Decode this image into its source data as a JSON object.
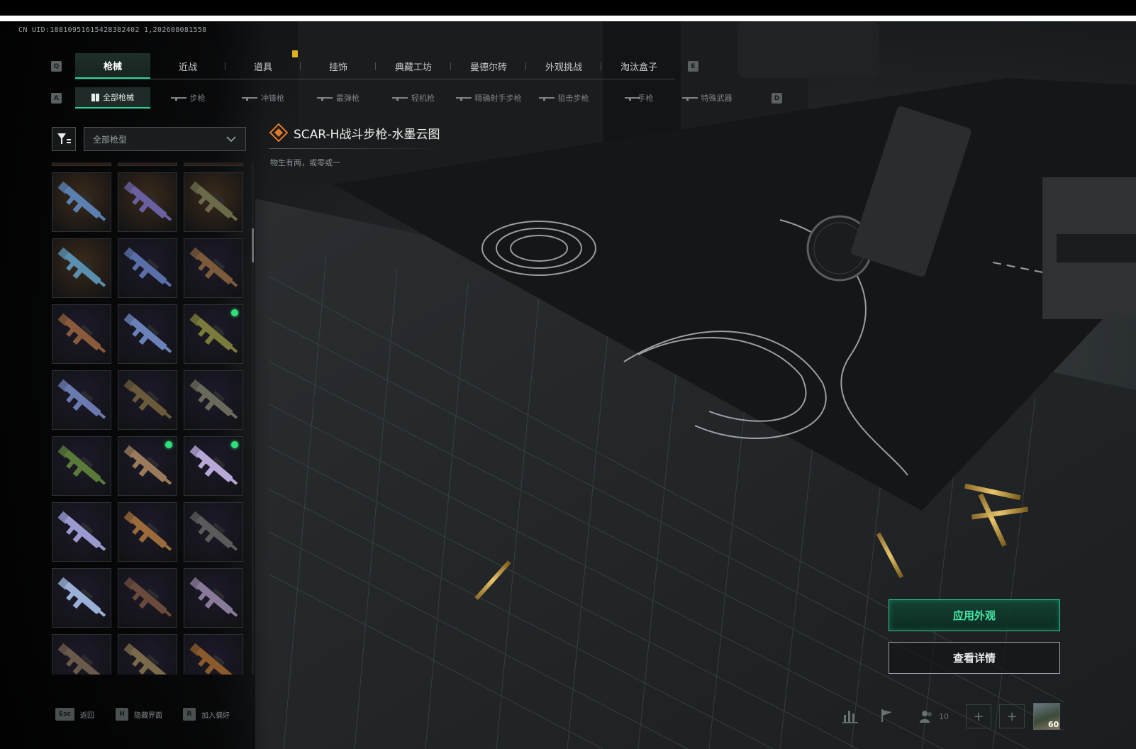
{
  "uid_text": "CN UID:18810951615428382402 1,202608081558",
  "main_tabs": {
    "left_key": "Q",
    "right_key": "E",
    "items": [
      {
        "label": "枪械"
      },
      {
        "label": "近战"
      },
      {
        "label": "道具"
      },
      {
        "label": "挂饰"
      },
      {
        "label": "典藏工坊"
      },
      {
        "label": "曼德尔砖"
      },
      {
        "label": "外观挑战"
      },
      {
        "label": "淘汰盒子"
      }
    ]
  },
  "sub_tabs": {
    "left_key": "A",
    "right_key": "D",
    "items": [
      {
        "label": "全部枪械",
        "icon": "grid-icon"
      },
      {
        "label": "步枪",
        "icon": "rifle-icon"
      },
      {
        "label": "冲锋枪",
        "icon": "smg-icon"
      },
      {
        "label": "霰弹枪",
        "icon": "shotgun-icon"
      },
      {
        "label": "轻机枪",
        "icon": "lmg-icon"
      },
      {
        "label": "精确射手步枪",
        "icon": "dmr-icon"
      },
      {
        "label": "狙击步枪",
        "icon": "sniper-icon"
      },
      {
        "label": "手枪",
        "icon": "pistol-icon"
      },
      {
        "label": "特殊武器",
        "icon": "special-weapon-icon"
      }
    ]
  },
  "filter": {
    "dropdown_value": "全部枪型"
  },
  "weapon_grid": {
    "items": [
      {
        "bg": "#3a2a1a",
        "color": "#5a7fb0",
        "new": false
      },
      {
        "bg": "#3a2a1a",
        "color": "#6a5fa0",
        "new": false
      },
      {
        "bg": "#3a2a1a",
        "color": "#6a6a4a",
        "new": false
      },
      {
        "bg": "#3a2a1a",
        "color": "#5a8fb0",
        "new": false
      },
      {
        "bg": "#1c1a2a",
        "color": "#5a6fa8",
        "new": false
      },
      {
        "bg": "#1c1a2a",
        "color": "#7a5a3a",
        "new": false
      },
      {
        "bg": "#1c1a2a",
        "color": "#8a5a3a",
        "new": false
      },
      {
        "bg": "#1c1a2a",
        "color": "#6a82b8",
        "new": false
      },
      {
        "bg": "#1c1a2a",
        "color": "#7a7a3a",
        "new": true
      },
      {
        "bg": "#1c1a2a",
        "color": "#6a7ab0",
        "new": false
      },
      {
        "bg": "#1c1a2a",
        "color": "#6a5a3a",
        "new": false
      },
      {
        "bg": "#1c1a2a",
        "color": "#6a6a5a",
        "new": false
      },
      {
        "bg": "#1c1a2a",
        "color": "#5a7a3a",
        "new": false
      },
      {
        "bg": "#1c1a2a",
        "color": "#9a7a5a",
        "new": true
      },
      {
        "bg": "#1c1a2a",
        "color": "#b8a8d8",
        "new": true
      },
      {
        "bg": "#1c1a2a",
        "color": "#9a9ad0",
        "new": false
      },
      {
        "bg": "#1c1a2a",
        "color": "#9a6a3a",
        "new": false
      },
      {
        "bg": "#1c1a2a",
        "color": "#5a5a5a",
        "new": false
      },
      {
        "bg": "#1c1a2a",
        "color": "#9ab0d8",
        "new": false
      },
      {
        "bg": "#1c1a2a",
        "color": "#6a4a3a",
        "new": false
      },
      {
        "bg": "#1c1a2a",
        "color": "#8a7a9a",
        "new": false
      },
      {
        "bg": "#1c1a2a",
        "color": "#6a5a4a",
        "new": false
      },
      {
        "bg": "#1c1a2a",
        "color": "#7a6a4a",
        "new": false
      },
      {
        "bg": "#1c1a2a",
        "color": "#8a5a2a",
        "new": false
      }
    ]
  },
  "item": {
    "title": "SCAR-H战斗步枪-水墨云图",
    "description": "物生有两，或零或一",
    "rarity_icon": "diamond-rarity-icon"
  },
  "actions": {
    "apply_label": "应用外观",
    "details_label": "查看详情"
  },
  "bottom_bar": {
    "hints": [
      {
        "key": "Esc",
        "label": "返回"
      },
      {
        "key": "H",
        "label": "隐藏界面"
      },
      {
        "key": "R",
        "label": "加入偏好"
      }
    ],
    "friends_count": "10",
    "player_level": "60"
  },
  "colors": {
    "accent_green": "#27d39a",
    "new_dot": "#2fe07a",
    "notif_yellow": "#e0b21e",
    "rarity_orange": "#e07a2a"
  }
}
